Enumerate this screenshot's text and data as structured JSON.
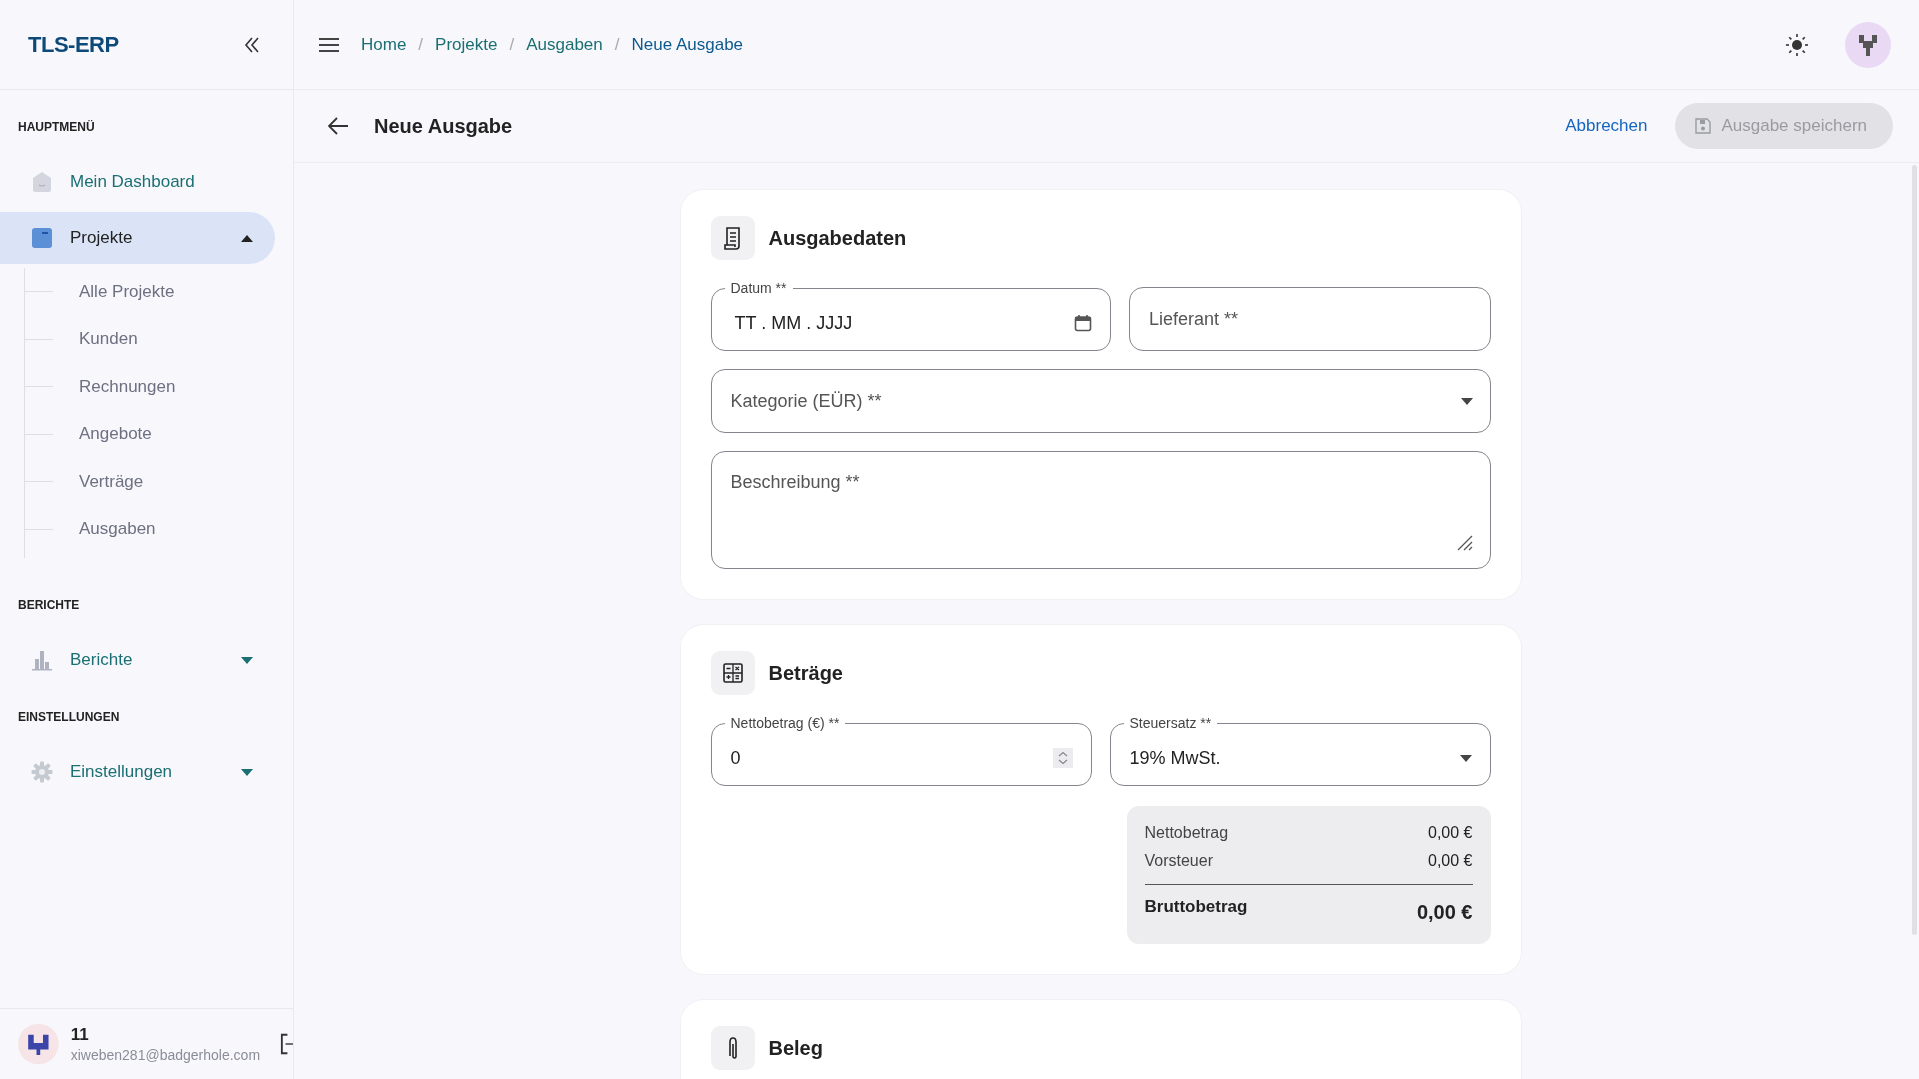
{
  "sidebar": {
    "logo": "TLS-ERP",
    "sections": [
      {
        "title": "HAUPTMENÜ",
        "items": [
          {
            "label": "Mein Dashboard",
            "kind": "link",
            "selected": false
          },
          {
            "label": "Projekte",
            "kind": "group",
            "selected": true,
            "expanded": true,
            "children": [
              {
                "label": "Alle Projekte"
              },
              {
                "label": "Kunden"
              },
              {
                "label": "Rechnungen"
              },
              {
                "label": "Angebote"
              },
              {
                "label": "Verträge"
              },
              {
                "label": "Ausgaben"
              }
            ]
          }
        ]
      },
      {
        "title": "BERICHTE",
        "items": [
          {
            "label": "Berichte",
            "kind": "group",
            "selected": false,
            "expanded": false
          }
        ]
      },
      {
        "title": "EINSTELLUNGEN",
        "items": [
          {
            "label": "Einstellungen",
            "kind": "group",
            "selected": false,
            "expanded": false
          }
        ]
      }
    ],
    "user": {
      "name": "11",
      "email": "xiweben281@badgerhole.com"
    }
  },
  "breadcrumb": {
    "items": [
      "Home",
      "Projekte",
      "Ausgaben",
      "Neue Ausgabe"
    ],
    "separators": [
      "/",
      "/",
      "/"
    ]
  },
  "page_header": {
    "title": "Neue Ausgabe",
    "cancel": "Abbrechen",
    "save": {
      "label": "Ausgabe speichern",
      "disabled": true
    }
  },
  "cards": [
    {
      "title": "Ausgabedaten",
      "rows": [
        [
          {
            "kind": "date",
            "label": "Datum **",
            "value": "TT . MM . JJJJ"
          },
          {
            "kind": "text",
            "placeholder": "Lieferant **"
          }
        ],
        [
          {
            "kind": "select",
            "placeholder": "Kategorie (EÜR) **"
          }
        ],
        [
          {
            "kind": "textarea",
            "placeholder": "Beschreibung **"
          }
        ]
      ]
    },
    {
      "title": "Beträge",
      "rows": [
        [
          {
            "kind": "number",
            "label": "Nettobetrag (€) **",
            "value": "0"
          },
          {
            "kind": "select",
            "label": "Steuersatz **",
            "value": "19% MwSt."
          }
        ]
      ],
      "summary": {
        "rows": [
          {
            "label": "Nettobetrag",
            "value": "0,00 €"
          },
          {
            "label": "Vorsteuer",
            "value": "0,00 €"
          }
        ],
        "total": {
          "label": "Bruttobetrag",
          "value": "0,00 €"
        }
      }
    },
    {
      "title": "Beleg"
    }
  ]
}
